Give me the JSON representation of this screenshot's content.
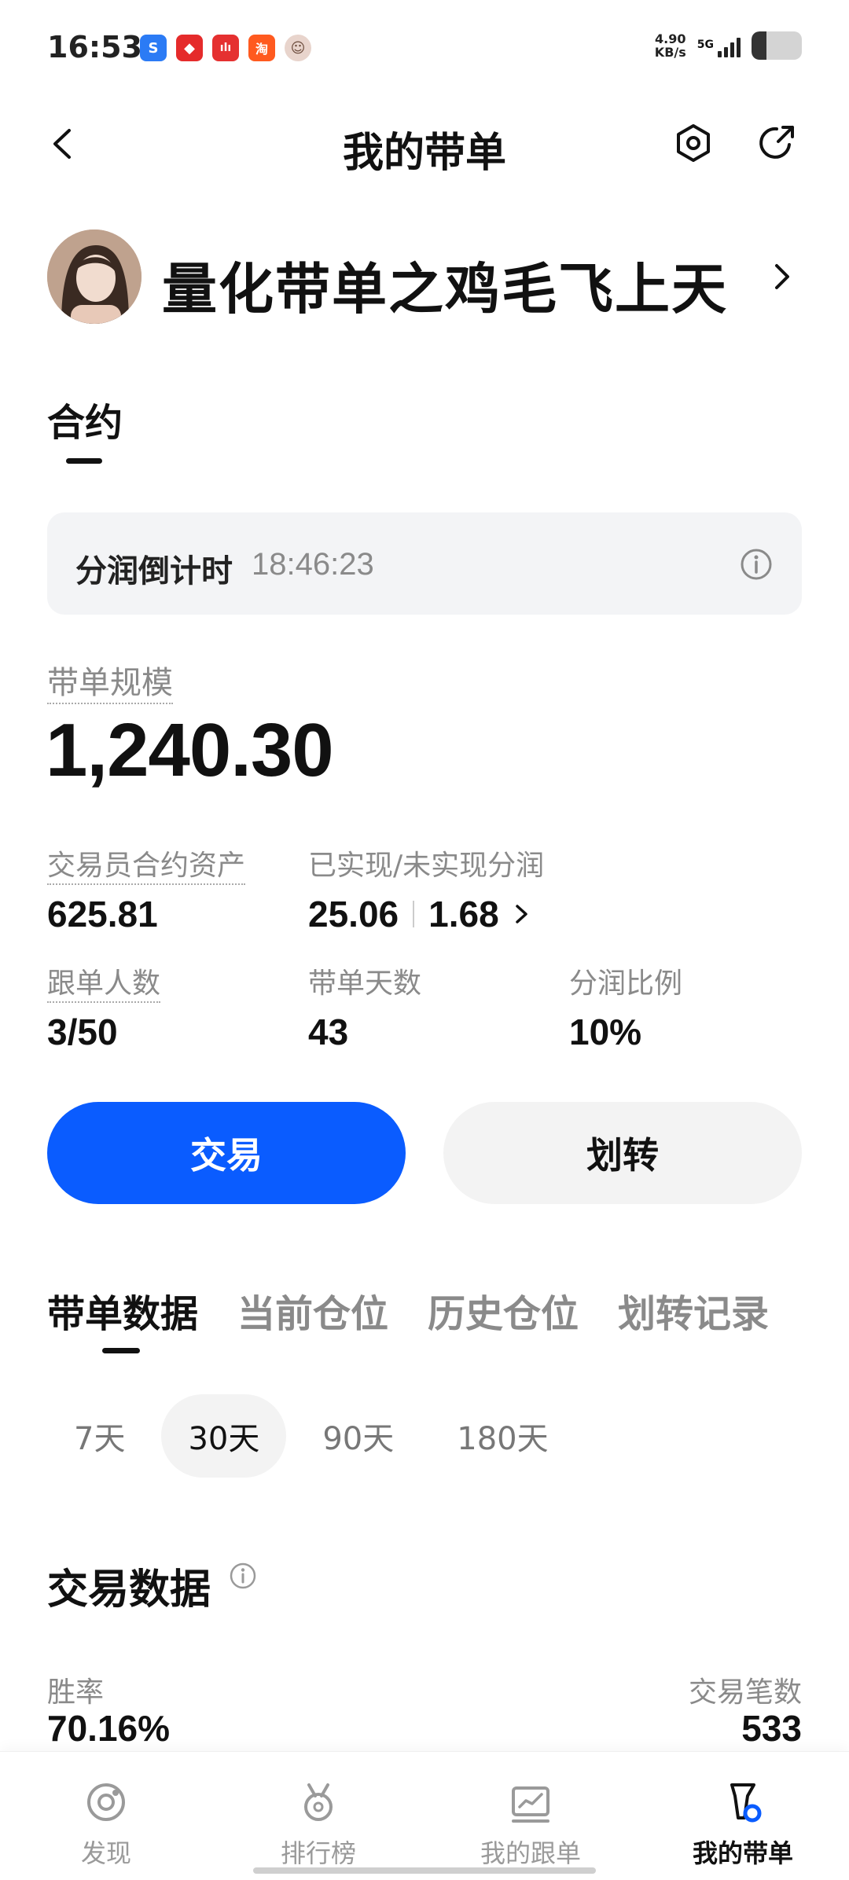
{
  "status_bar": {
    "time": "16:53",
    "net_speed_value": "4.90",
    "net_speed_unit": "KB/s",
    "network_type": "5G",
    "battery_level": 0.3,
    "apps": [
      {
        "icon": "baidu-app-icon",
        "color": "#2b7bf5",
        "glyph": "S"
      },
      {
        "icon": "red-app-icon",
        "color": "#e52b2b",
        "glyph": "◆"
      },
      {
        "icon": "music-app-icon",
        "color": "#e53030",
        "glyph": "ılı"
      },
      {
        "icon": "taobao-app-icon",
        "color": "#ff5a1f",
        "glyph": "淘"
      },
      {
        "icon": "avatar-app-icon",
        "color": "#e8d4cc",
        "glyph": "☺"
      }
    ]
  },
  "header": {
    "title": "我的带单"
  },
  "profile": {
    "name": "量化带单之鸡毛飞上天"
  },
  "contract": {
    "tab_label": "合约"
  },
  "countdown": {
    "label": "分润倒计时",
    "value": "18:46:23"
  },
  "scale": {
    "label": "带单规模",
    "value": "1,240.30"
  },
  "stats": {
    "trader_assets_label": "交易员合约资产",
    "trader_assets_value": "625.81",
    "pnl_label": "已实现/未实现分润",
    "realized_value": "25.06",
    "unrealized_value": "1.68",
    "followers_label": "跟单人数",
    "followers_value": "3/50",
    "days_label": "带单天数",
    "days_value": "43",
    "share_ratio_label": "分润比例",
    "share_ratio_value": "10%"
  },
  "actions": {
    "trade_label": "交易",
    "transfer_label": "划转"
  },
  "data_tabs": [
    "带单数据",
    "当前仓位",
    "历史仓位",
    "划转记录"
  ],
  "periods": [
    "7天",
    "30天",
    "90天",
    "180天"
  ],
  "trade_data": {
    "title": "交易数据",
    "win_rate_label": "胜率",
    "win_rate_value": "70.16%",
    "trade_count_label": "交易笔数",
    "trade_count_value": "533"
  },
  "bottom_nav": [
    {
      "label": "发现",
      "icon": "discover-icon"
    },
    {
      "label": "排行榜",
      "icon": "ranking-medal-icon"
    },
    {
      "label": "我的跟单",
      "icon": "my-follow-chart-icon"
    },
    {
      "label": "我的带单",
      "icon": "my-lead-icon"
    }
  ],
  "colors": {
    "accent": "#0a5cff",
    "muted_text": "#8a8a8a",
    "chip_bg": "#f3f3f3"
  }
}
